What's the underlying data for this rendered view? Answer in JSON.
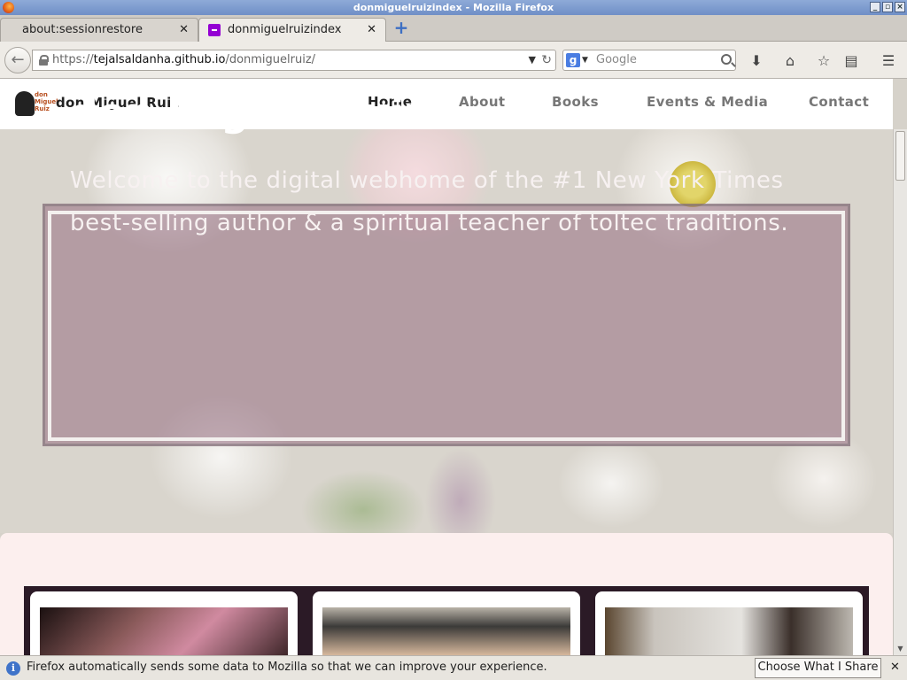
{
  "window": {
    "title": "donmiguelruizindex - Mozilla Firefox"
  },
  "tabs": [
    {
      "label": "about:sessionrestore",
      "active": false
    },
    {
      "label": "donmiguelruizindex",
      "active": true
    }
  ],
  "navbar": {
    "url_prefix": "https://",
    "url_host": "tejalsaldanha.github.io",
    "url_path": "/donmiguelruiz/",
    "search_placeholder": "Google"
  },
  "site": {
    "logo_text": "don Miguel Ruiz",
    "name": "don Miguel Ruiz",
    "nav": [
      "Home",
      "About",
      "Books",
      "Events & Media",
      "Contact"
    ],
    "current_nav": "Home"
  },
  "hero": {
    "title": "don Miguel Ruiz",
    "text": "Welcome to the digital webhome of the #1 New York Times best-selling author & a spiritual teacher of toltec traditions."
  },
  "notification": {
    "message": "Firefox automatically sends some data to Mozilla so that we can improve your experience.",
    "button": "Choose What I Share"
  },
  "colors": {
    "hero_panel": "#96708a",
    "card_row": "#2b1a26",
    "lower_bg": "#fcefee"
  },
  "icons": [
    "firefox-icon",
    "close-icon",
    "new-tab-icon",
    "back-icon",
    "lock-icon",
    "dropdown-icon",
    "reload-icon",
    "google-icon",
    "search-icon",
    "download-icon",
    "home-icon",
    "bookmark-star-icon",
    "reading-list-icon",
    "menu-icon",
    "info-icon"
  ]
}
